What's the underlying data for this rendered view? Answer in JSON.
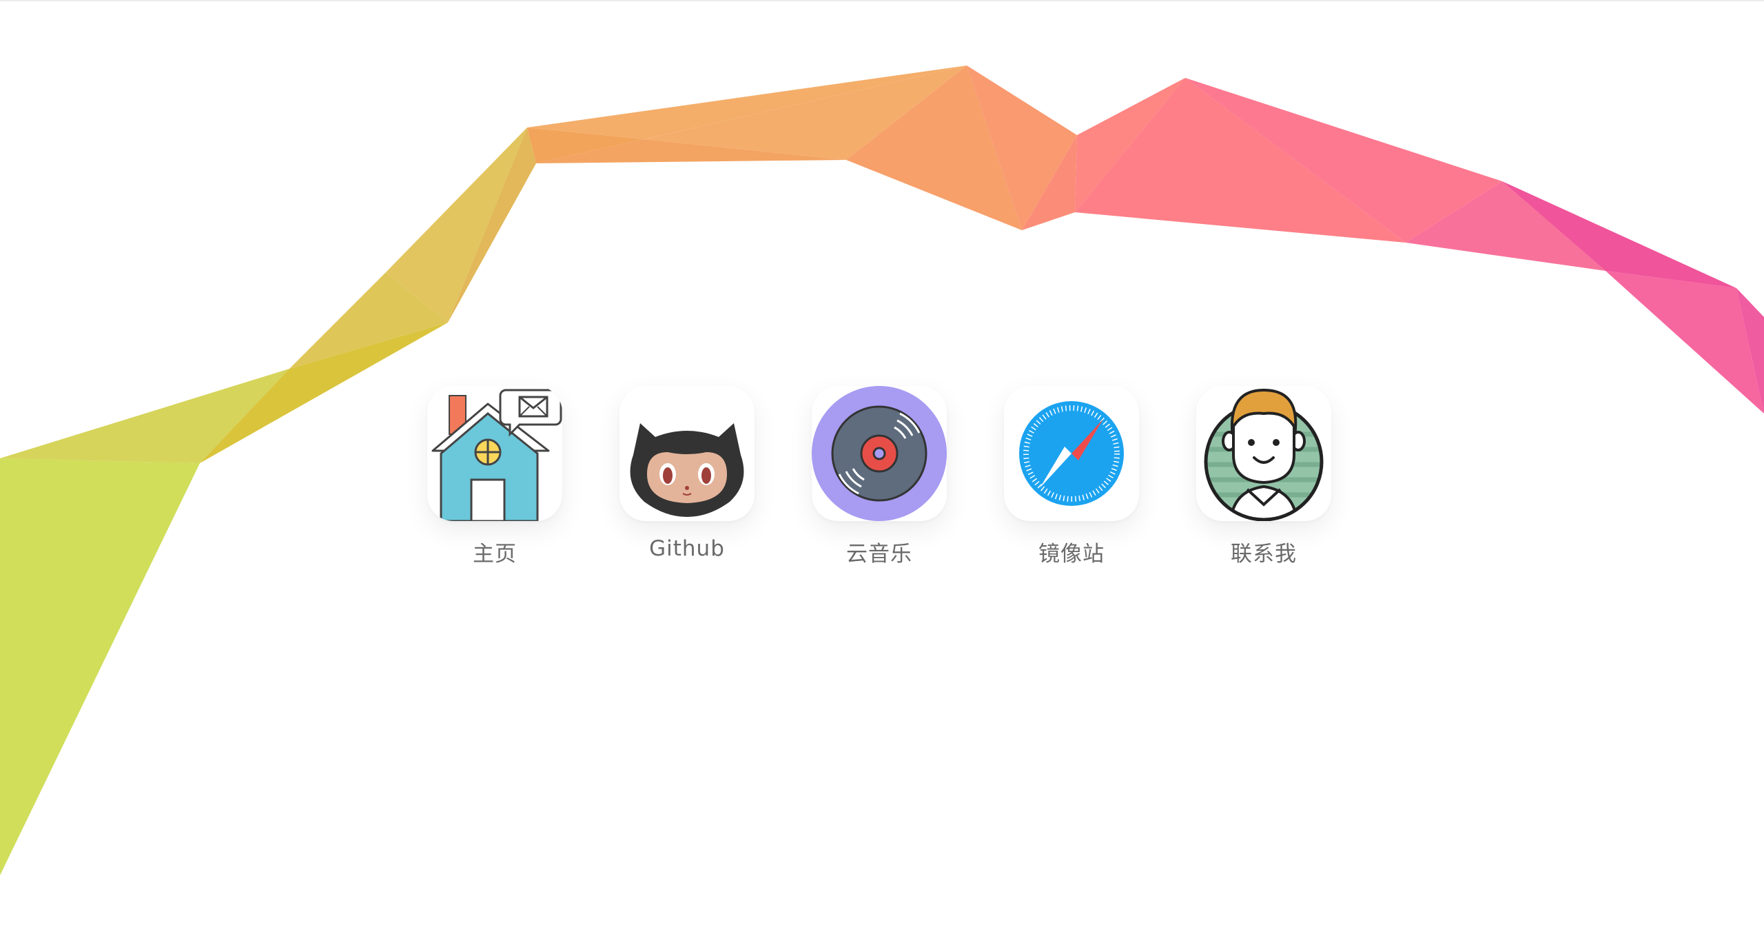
{
  "apps": [
    {
      "id": "home",
      "label": "主页",
      "icon": "house-mail-icon"
    },
    {
      "id": "github",
      "label": "Github",
      "icon": "octocat-icon"
    },
    {
      "id": "music",
      "label": "云音乐",
      "icon": "vinyl-record-icon"
    },
    {
      "id": "mirror",
      "label": "镜像站",
      "icon": "compass-icon"
    },
    {
      "id": "contact",
      "label": "联系我",
      "icon": "person-avatar-icon"
    }
  ],
  "colors": {
    "ribbon_start": "#d2e05a",
    "ribbon_mid": "#f3a766",
    "ribbon_end": "#f4659c",
    "label": "#6a6a6a"
  }
}
